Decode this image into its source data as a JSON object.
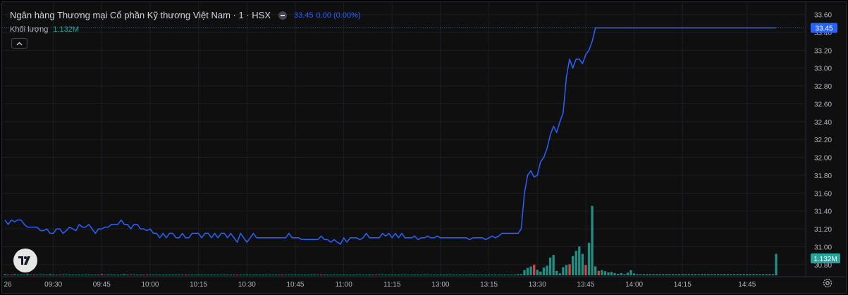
{
  "legend": {
    "symbol_title": "Ngân hàng Thương mại Cổ phần Kỹ thương Việt Nam · 1 · HSX",
    "last_price": "33.45",
    "change": "0.00 (0.00%)",
    "volume_label": "Khối lượng",
    "volume_value": "1.132M"
  },
  "icons": {
    "visibility": "eye-minus-icon",
    "collapse": "chevron-up-icon",
    "logo": "tradingview-logo-icon",
    "settings": "gear-icon"
  },
  "colors": {
    "background": "#0f0f0f",
    "price_line": "#2962ff",
    "volume_up": "#26a69a",
    "volume_down": "#ef5350",
    "volume_badge": "#26a69a",
    "text": "#b2b5be"
  },
  "chart_data": {
    "type": "line",
    "symbol": "Ngân hàng Thương mại Cổ phần Kỹ thương Việt Nam",
    "exchange": "HSX",
    "interval": "1",
    "x_start_label": "26",
    "x_ticks": [
      "09:30",
      "09:45",
      "10:00",
      "10:15",
      "10:30",
      "10:45",
      "11:00",
      "11:15",
      "13:00",
      "13:15",
      "13:30",
      "13:45",
      "14:00",
      "14:15",
      "14:45"
    ],
    "y_ticks": [
      30.8,
      31.0,
      31.2,
      31.4,
      31.6,
      31.8,
      32.0,
      32.2,
      32.4,
      32.6,
      32.8,
      33.0,
      33.2,
      33.4,
      33.6
    ],
    "ylim": [
      30.72,
      33.66
    ],
    "price_label": "33.45",
    "volume_label": "1.132M",
    "grid": true,
    "price_series": [
      31.3,
      31.25,
      31.3,
      31.28,
      31.3,
      31.3,
      31.25,
      31.22,
      31.22,
      31.22,
      31.22,
      31.18,
      31.18,
      31.2,
      31.15,
      31.15,
      31.2,
      31.2,
      31.15,
      31.18,
      31.22,
      31.2,
      31.18,
      31.25,
      31.22,
      31.22,
      31.25,
      31.2,
      31.15,
      31.2,
      31.2,
      31.22,
      31.22,
      31.25,
      31.25,
      31.25,
      31.3,
      31.25,
      31.25,
      31.2,
      31.25,
      31.25,
      31.2,
      31.2,
      31.18,
      31.2,
      31.15,
      31.15,
      31.1,
      31.15,
      31.1,
      31.15,
      31.15,
      31.1,
      31.1,
      31.15,
      31.1,
      31.1,
      31.15,
      31.15,
      31.15,
      31.1,
      31.15,
      31.15,
      31.1,
      31.15,
      31.1,
      31.15,
      31.15,
      31.1,
      31.15,
      31.1,
      31.05,
      31.15,
      31.1,
      31.05,
      31.1,
      31.15,
      31.1,
      31.1,
      31.1,
      31.1,
      31.1,
      31.1,
      31.1,
      31.1,
      31.1,
      31.1,
      31.15,
      31.1,
      31.1,
      31.1,
      31.08,
      31.08,
      31.08,
      31.08,
      31.08,
      31.08,
      31.12,
      31.08,
      31.08,
      31.05,
      31.08,
      31.05,
      31.03,
      31.1,
      31.05,
      31.1,
      31.1,
      31.1,
      31.08,
      31.1,
      31.15,
      31.1,
      31.1,
      31.1,
      31.1,
      31.15,
      31.12,
      31.15,
      31.1,
      31.15,
      31.1,
      31.15,
      31.1,
      31.1,
      31.1,
      31.12,
      31.08,
      31.1,
      31.1,
      31.12,
      31.1,
      31.1,
      31.12,
      31.1,
      31.1,
      31.1,
      31.1,
      31.1,
      31.1,
      31.1,
      31.1,
      31.1,
      31.08,
      31.1,
      31.1,
      31.1,
      31.1,
      31.08,
      31.1,
      31.12,
      31.1,
      31.12,
      31.15,
      31.15,
      31.15,
      31.15,
      31.15,
      31.15,
      31.2,
      31.6,
      31.8,
      31.85,
      31.78,
      31.8,
      31.95,
      32.0,
      32.1,
      32.25,
      32.35,
      32.28,
      32.4,
      32.5,
      32.9,
      33.1,
      33.0,
      33.1,
      33.1,
      33.05,
      33.15,
      33.2,
      33.3,
      33.45,
      33.45,
      33.45,
      33.45,
      33.45,
      33.45,
      33.45,
      33.45,
      33.45,
      33.45,
      33.45,
      33.45,
      33.45,
      33.45,
      33.45,
      33.45,
      33.45,
      33.45,
      33.45,
      33.45,
      33.45,
      33.45,
      33.45,
      33.45,
      33.45,
      33.45,
      33.45,
      33.45,
      33.45,
      33.45,
      33.45,
      33.45,
      33.45,
      33.45,
      33.45,
      33.45,
      33.45,
      33.45,
      33.45,
      33.45,
      33.45,
      33.45,
      33.45,
      33.45,
      33.45,
      33.45,
      33.45,
      33.45,
      33.45,
      33.45,
      33.45,
      33.45,
      33.45,
      33.45,
      33.45,
      33.45,
      33.45
    ],
    "volume_series": [
      3,
      2,
      2,
      3,
      2,
      2,
      2,
      3,
      2,
      2,
      2,
      2,
      2,
      2,
      3,
      2,
      2,
      2,
      2,
      2,
      2,
      2,
      2,
      2,
      2,
      2,
      2,
      2,
      2,
      2,
      3,
      2,
      2,
      2,
      2,
      2,
      2,
      3,
      2,
      2,
      2,
      2,
      2,
      2,
      2,
      2,
      2,
      2,
      2,
      2,
      2,
      2,
      2,
      2,
      2,
      2,
      2,
      2,
      2,
      2,
      2,
      2,
      2,
      2,
      2,
      2,
      2,
      2,
      2,
      2,
      2,
      2,
      2,
      2,
      2,
      2,
      2,
      2,
      2,
      2,
      2,
      2,
      2,
      2,
      2,
      2,
      2,
      2,
      2,
      2,
      2,
      2,
      2,
      2,
      2,
      2,
      2,
      2,
      2,
      2,
      2,
      2,
      2,
      2,
      2,
      2,
      2,
      2,
      2,
      2,
      2,
      2,
      2,
      2,
      2,
      2,
      2,
      2,
      2,
      2,
      2,
      2,
      2,
      2,
      2,
      2,
      2,
      2,
      2,
      2,
      2,
      2,
      2,
      2,
      2,
      2,
      2,
      2,
      2,
      2,
      2,
      2,
      2,
      2,
      2,
      2,
      2,
      2,
      2,
      2,
      2,
      2,
      2,
      2,
      2,
      2,
      2,
      2,
      2,
      3,
      3,
      14,
      20,
      24,
      29,
      15,
      10,
      21,
      26,
      48,
      55,
      12,
      5,
      22,
      28,
      30,
      52,
      66,
      78,
      58,
      28,
      88,
      188,
      24,
      12,
      14,
      11,
      8,
      9,
      6,
      4,
      6,
      3,
      7,
      14,
      5,
      3,
      3,
      3,
      3,
      3,
      3,
      3,
      3,
      3,
      3,
      3,
      3,
      3,
      3,
      3,
      3,
      3,
      3,
      3,
      3,
      3,
      3,
      3,
      3,
      3,
      3,
      3,
      3,
      3,
      3,
      3,
      3,
      3,
      3,
      3,
      3,
      3,
      3,
      3,
      3,
      3,
      3,
      3,
      58
    ],
    "volume_direction": [
      "u",
      "u",
      "d",
      "u",
      "u",
      "u",
      "u",
      "u",
      "u",
      "d",
      "u",
      "u",
      "u",
      "u",
      "u",
      "u",
      "u",
      "d",
      "u",
      "u",
      "u",
      "u",
      "u",
      "u",
      "u",
      "u",
      "u",
      "u",
      "u",
      "u",
      "d",
      "u",
      "u",
      "u",
      "u",
      "u",
      "u",
      "u",
      "u",
      "d",
      "u",
      "u",
      "u",
      "u",
      "d",
      "u",
      "u",
      "u",
      "u",
      "u",
      "u",
      "u",
      "u",
      "u",
      "u",
      "u",
      "d",
      "u",
      "u",
      "u",
      "u",
      "u",
      "u",
      "u",
      "u",
      "u",
      "u",
      "u",
      "u",
      "u",
      "u",
      "u",
      "d",
      "u",
      "u",
      "u",
      "u",
      "u",
      "u",
      "u",
      "u",
      "u",
      "u",
      "u",
      "u",
      "u",
      "d",
      "u",
      "u",
      "u",
      "u",
      "u",
      "u",
      "u",
      "u",
      "u",
      "u",
      "u",
      "d",
      "u",
      "u",
      "u",
      "u",
      "u",
      "u",
      "u",
      "u",
      "u",
      "u",
      "u",
      "u",
      "u",
      "u",
      "u",
      "u",
      "d",
      "u",
      "u",
      "u",
      "u",
      "u",
      "u",
      "u",
      "u",
      "u",
      "u",
      "u",
      "u",
      "u",
      "u",
      "u",
      "u",
      "u",
      "u",
      "u",
      "u",
      "u",
      "u",
      "u",
      "u",
      "u",
      "u",
      "u",
      "u",
      "u",
      "u",
      "u",
      "u",
      "u",
      "u",
      "u",
      "u",
      "u",
      "u",
      "u",
      "u",
      "u",
      "u",
      "u",
      "u",
      "u",
      "u",
      "u",
      "u",
      "d",
      "u",
      "u",
      "u",
      "u",
      "u",
      "u",
      "u",
      "u",
      "u",
      "u",
      "d",
      "u",
      "u",
      "u",
      "u",
      "d",
      "u",
      "u",
      "u",
      "d",
      "u",
      "u",
      "u",
      "u",
      "u",
      "u",
      "u",
      "u",
      "u",
      "u",
      "u",
      "u",
      "u",
      "u",
      "u",
      "u",
      "u",
      "u",
      "u",
      "u",
      "u",
      "u",
      "u",
      "u",
      "u",
      "u",
      "u",
      "u",
      "u",
      "u",
      "u",
      "u",
      "u",
      "u",
      "u",
      "u",
      "u",
      "u",
      "u",
      "u",
      "u",
      "u",
      "u",
      "u",
      "u",
      "u",
      "u",
      "u",
      "u",
      "u",
      "u",
      "u",
      "u",
      "u",
      "u"
    ]
  }
}
